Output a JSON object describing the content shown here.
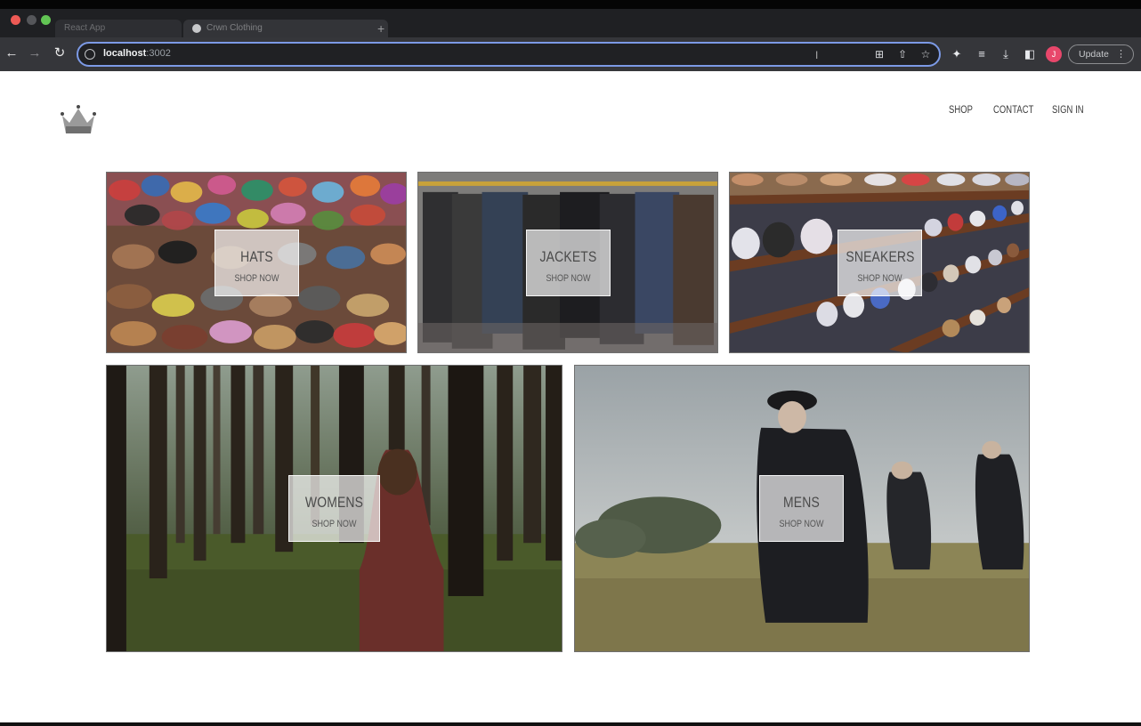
{
  "browser": {
    "tabs": [
      {
        "title": "React App"
      },
      {
        "title": "Crwn Clothing"
      }
    ],
    "new_tab_symbol": "+",
    "address": {
      "host": "localhost",
      "port": ":3002"
    },
    "update_label": "Update",
    "menu_dots": "⋮",
    "avatar_initial": "J"
  },
  "header": {
    "logo": "crown-icon",
    "nav": {
      "shop": "SHOP",
      "contact": "CONTACT",
      "sign_in": "SIGN IN"
    }
  },
  "categories": [
    {
      "title": "HATS",
      "subtitle": "SHOP NOW"
    },
    {
      "title": "JACKETS",
      "subtitle": "SHOP NOW"
    },
    {
      "title": "SNEAKERS",
      "subtitle": "SHOP NOW"
    },
    {
      "title": "WOMENS",
      "subtitle": "SHOP NOW"
    },
    {
      "title": "MENS",
      "subtitle": "SHOP NOW"
    }
  ],
  "colors": {
    "chrome_dark": "#35363a",
    "omnibox_focus": "#7c9ae6",
    "page_bg": "#ffffff",
    "nav_text": "#3a3a3a"
  }
}
